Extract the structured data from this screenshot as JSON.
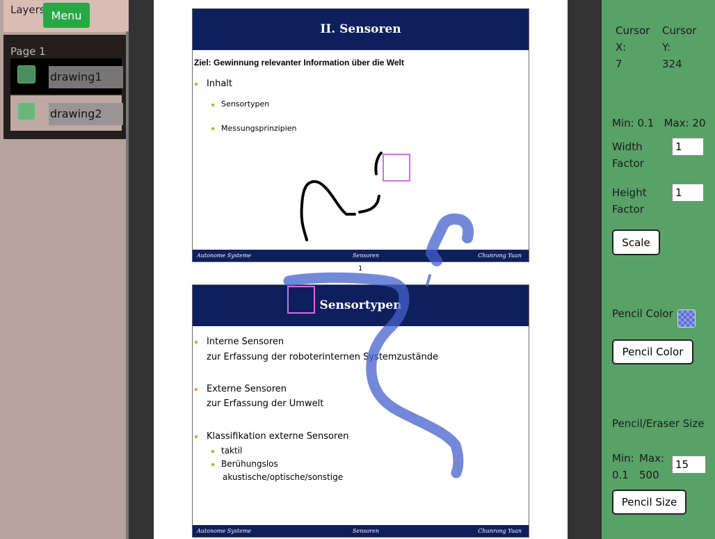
{
  "sidebar": {
    "layers_label": "Layers",
    "menu_label": "Menu",
    "page_title": "Page 1",
    "layers": [
      {
        "name": "drawing1",
        "color": "#4a8e5c"
      },
      {
        "name": "drawing2",
        "color": "#6db67b"
      }
    ]
  },
  "document": {
    "slide1": {
      "title": "II. Sensoren",
      "goal": "Ziel: Gewinnung relevanter Information über die Welt",
      "bullet1": "Inhalt",
      "sub1": "Sensortypen",
      "sub2": "Messungsprinzipien",
      "footer_left": "Autonome Systeme",
      "footer_center": "Sensoren",
      "footer_right": "Chunrong Yuan"
    },
    "page_number": "1",
    "slide2": {
      "title": "Sensortypen",
      "b1": "Interne Sensoren",
      "b1_desc": "zur Erfassung der roboterinternen Systemzustände",
      "b2": "Externe Sensoren",
      "b2_desc": "zur Erfassung der Umwelt",
      "b3": "Klassifikation externe Sensoren",
      "s1": "taktil",
      "s2": "Berühungslos",
      "s2_desc": "akustische/optische/sonstige",
      "footer_left": "Autonome Systeme",
      "footer_center": "Sensoren",
      "footer_right": "Chunrong Yuan"
    }
  },
  "right_panel": {
    "cursor_x_label": "Cursor X:",
    "cursor_x_value": "7",
    "cursor_y_label": "Cursor Y:",
    "cursor_y_value": "324",
    "scale_range": "Min: 0.1   Max: 20",
    "width_factor_label": "Width Factor",
    "width_factor_value": "1",
    "height_factor_label": "Height Factor",
    "height_factor_value": "1",
    "scale_button": "Scale",
    "pencil_color_label": "Pencil Color",
    "pencil_color_value": "#5b6fd6",
    "pencil_color_button": "Pencil Color",
    "size_label": "Pencil/Eraser Size",
    "size_min": "Min: 0.1",
    "size_max": "Max: 500",
    "size_value": "15",
    "size_button": "Pencil Size"
  }
}
